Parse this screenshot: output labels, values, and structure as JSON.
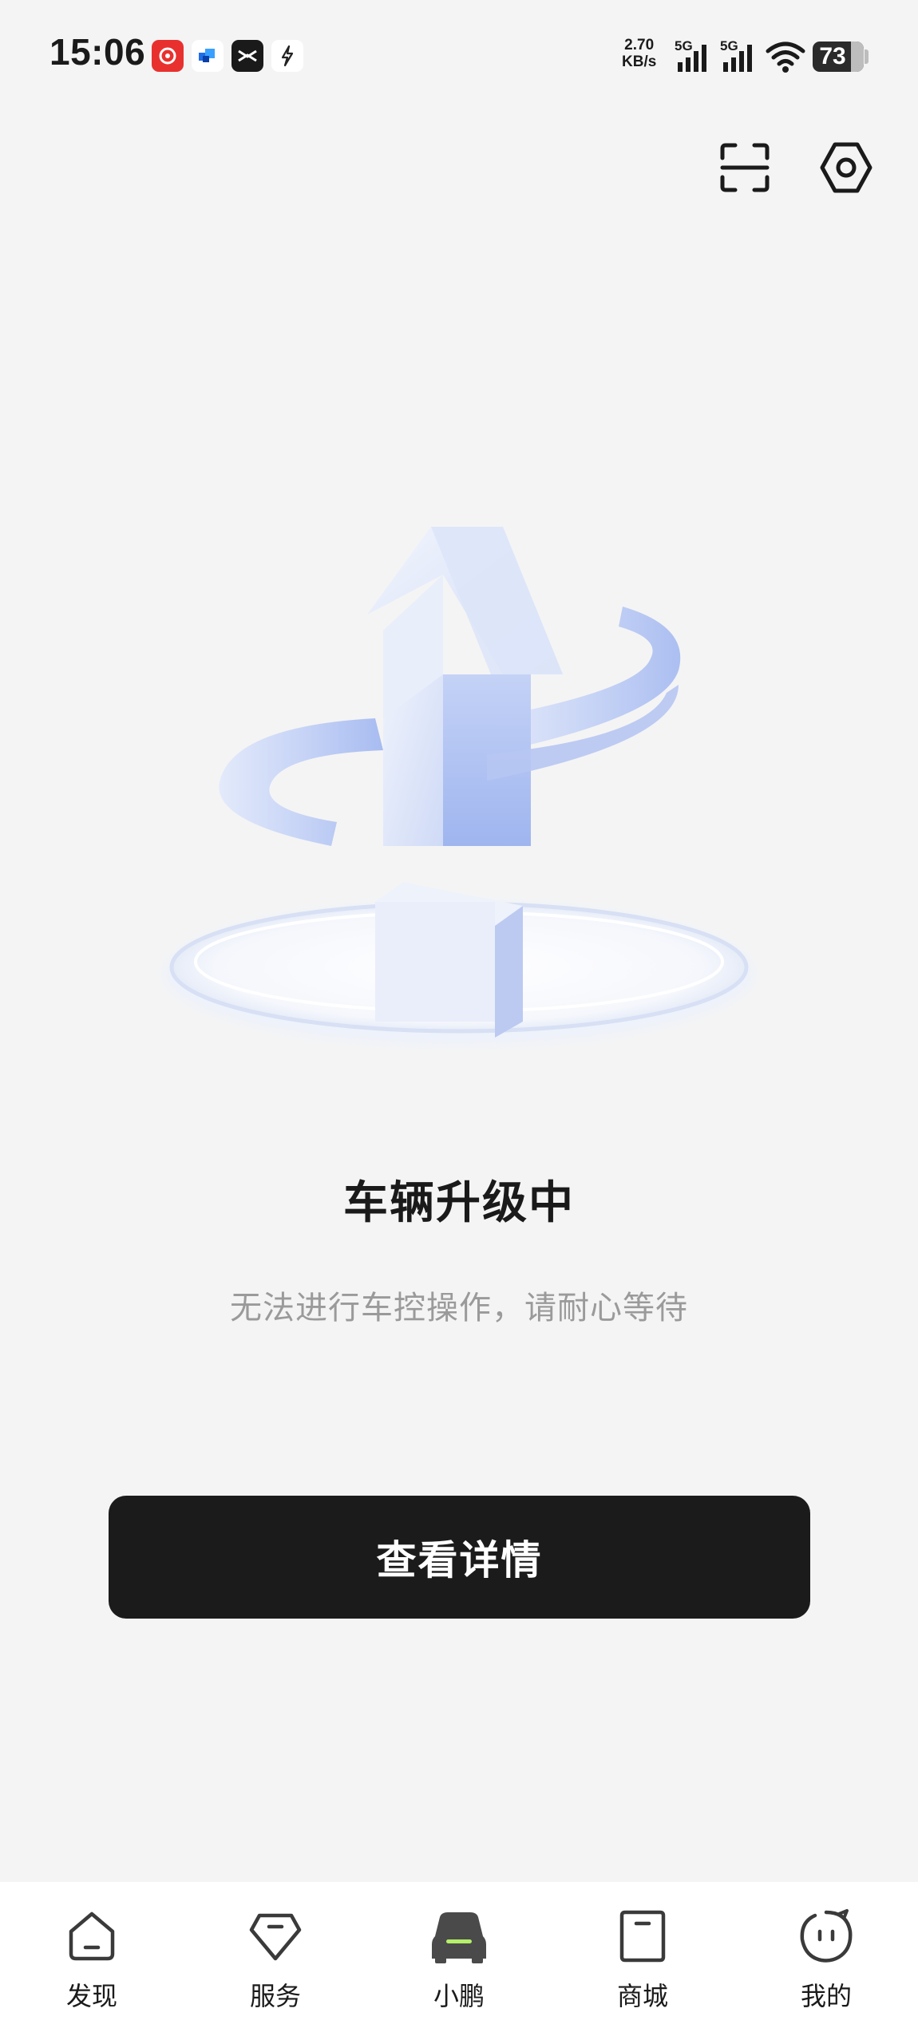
{
  "status_bar": {
    "time": "15:06",
    "net_speed_value": "2.70",
    "net_speed_unit": "KB/s",
    "signal_1_label": "5G",
    "signal_2_label": "5G",
    "battery": "73",
    "notification_icons": [
      "netease-music-icon",
      "blue-app-icon",
      "xpeng-app-icon",
      "bolt-app-icon"
    ]
  },
  "top_actions": {
    "scan_icon": "scan-icon",
    "settings_icon": "hexagon-settings-icon"
  },
  "hero": {
    "illustration": "upgrade-arrow-illustration"
  },
  "main": {
    "title": "车辆升级中",
    "subtitle": "无法进行车控操作，请耐心等待",
    "button_label": "查看详情"
  },
  "tab_bar": {
    "items": [
      {
        "label": "发现",
        "icon": "discover-icon"
      },
      {
        "label": "服务",
        "icon": "service-icon"
      },
      {
        "label": "小鹏",
        "icon": "car-icon"
      },
      {
        "label": "商城",
        "icon": "shop-icon"
      },
      {
        "label": "我的",
        "icon": "profile-icon"
      }
    ]
  },
  "colors": {
    "background": "#f4f4f4",
    "button": "#1b1b1b",
    "accent_green": "#b4f06a",
    "subtitle_gray": "#9a9a9a"
  }
}
